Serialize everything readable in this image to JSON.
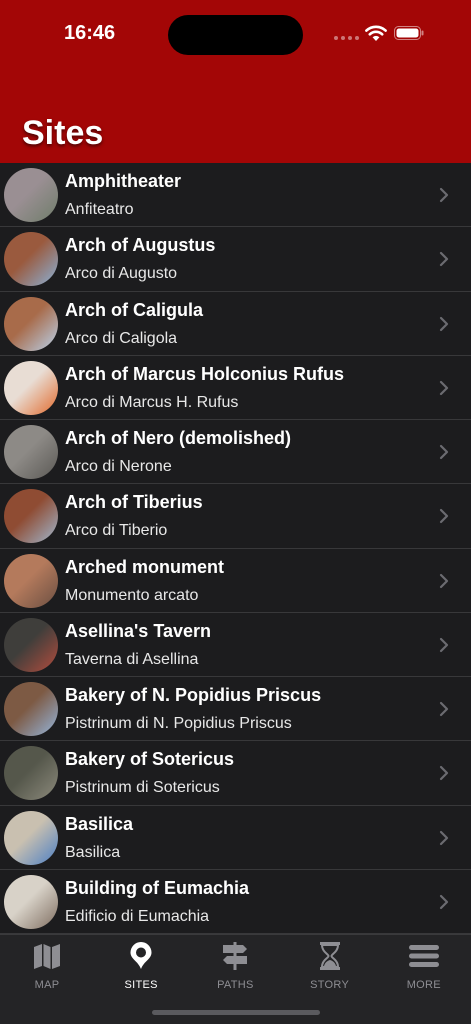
{
  "status_bar": {
    "time": "16:46"
  },
  "header": {
    "title": "Sites"
  },
  "sites": [
    {
      "name": "Amphitheater",
      "italian": "Anfiteatro",
      "colors": [
        "#9a8f93",
        "#6f7d6a"
      ]
    },
    {
      "name": "Arch of Augustus",
      "italian": "Arco di Augusto",
      "colors": [
        "#9a5a3e",
        "#8ab2d8"
      ]
    },
    {
      "name": "Arch of Caligula",
      "italian": "Arco di Caligola",
      "colors": [
        "#a86b4a",
        "#b9d3ec"
      ]
    },
    {
      "name": "Arch of Marcus Holconius Rufus",
      "italian": "Arco di Marcus H. Rufus",
      "colors": [
        "#e8ddd4",
        "#e26a2c"
      ]
    },
    {
      "name": "Arch of Nero (demolished)",
      "italian": "Arco di Nerone",
      "colors": [
        "#8d8a86",
        "#5b5955"
      ]
    },
    {
      "name": "Arch of Tiberius",
      "italian": "Arco di Tiberio",
      "colors": [
        "#8f4c33",
        "#9fb8cf"
      ]
    },
    {
      "name": "Arched monument",
      "italian": "Monumento arcato",
      "colors": [
        "#b47a5c",
        "#6b4f42"
      ]
    },
    {
      "name": "Asellina's Tavern",
      "italian": "Taverna di Asellina",
      "colors": [
        "#3f3e3b",
        "#b44d3e"
      ]
    },
    {
      "name": "Bakery of N. Popidius Priscus",
      "italian": "Pistrinum di N. Popidius Priscus",
      "colors": [
        "#7d5a44",
        "#95b6dc"
      ]
    },
    {
      "name": "Bakery of Sotericus",
      "italian": "Pistrinum di Sotericus",
      "colors": [
        "#55574b",
        "#8c8a7c"
      ]
    },
    {
      "name": "Basilica",
      "italian": "Basilica",
      "colors": [
        "#c9c0b0",
        "#4c7fc4"
      ]
    },
    {
      "name": "Building of Eumachia",
      "italian": "Edificio di Eumachia",
      "colors": [
        "#d8d2c8",
        "#7f6e61"
      ]
    }
  ],
  "tabs": [
    {
      "label": "MAP",
      "icon": "map-icon",
      "active": false
    },
    {
      "label": "SITES",
      "icon": "map-pin-icon",
      "active": true
    },
    {
      "label": "PATHS",
      "icon": "signpost-icon",
      "active": false
    },
    {
      "label": "STORY",
      "icon": "hourglass-icon",
      "active": false
    },
    {
      "label": "MORE",
      "icon": "menu-icon",
      "active": false
    }
  ]
}
